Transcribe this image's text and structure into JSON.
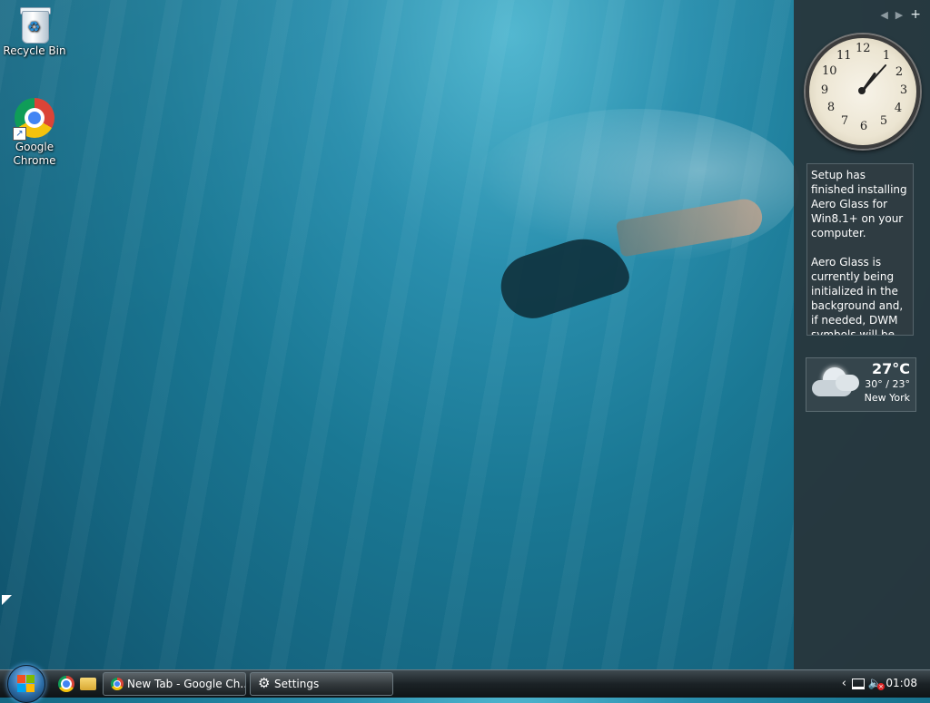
{
  "desktop": {
    "icons": [
      {
        "label": "Recycle Bin",
        "icon": "recycle-bin-icon"
      },
      {
        "label": "Google\nChrome",
        "label_line1": "Google",
        "label_line2": "Chrome",
        "icon": "chrome-icon"
      }
    ]
  },
  "sidebar": {
    "controls": {
      "prev": "◀",
      "next": "▶",
      "add": "+"
    },
    "clock": {
      "numbers": [
        "12",
        "1",
        "2",
        "3",
        "4",
        "5",
        "6",
        "7",
        "8",
        "9",
        "10",
        "11"
      ],
      "time_shown": "1:08"
    },
    "notice": {
      "paragraph1": "Setup has finished installing Aero Glass for Win8.1+ on your computer.",
      "paragraph2": "Aero Glass is currently being initialized in the background and, if needed, DWM symbols will be downloaded"
    },
    "weather": {
      "temp": "27°C",
      "range": "30° / 23°",
      "city": "New York",
      "icon": "cloudy-night-icon"
    }
  },
  "taskbar": {
    "start_icon": "windows-orb-icon",
    "quick_launch": [
      {
        "icon": "chrome-icon"
      },
      {
        "icon": "folder-icon"
      }
    ],
    "buttons": [
      {
        "label": "New Tab - Google Ch...",
        "icon": "chrome-icon"
      },
      {
        "label": "Settings",
        "icon": "gear-icon"
      }
    ],
    "tray": {
      "chevron": "‹",
      "time": "01:08"
    }
  },
  "colors": {
    "sidebar_bg": "#28343a",
    "taskbar_bg": "#1b2226",
    "desktop_water": "#1a7894"
  }
}
